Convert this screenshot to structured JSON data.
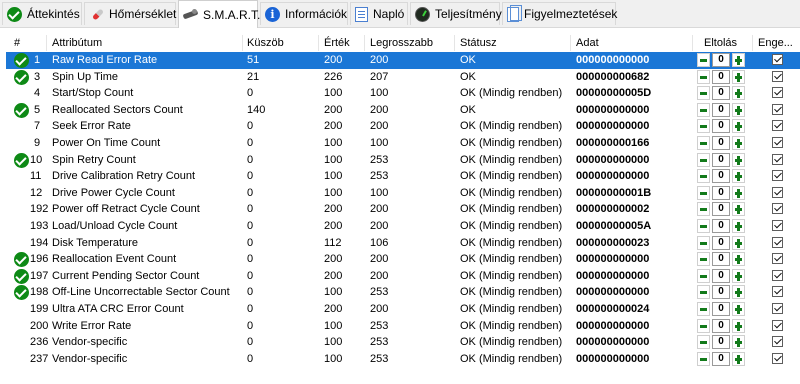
{
  "tabs": [
    {
      "label": "Áttekintés",
      "icon": "check-circle-icon"
    },
    {
      "label": "Hőmérséklet",
      "icon": "thermometer-icon"
    },
    {
      "label": "S.M.A.R.T.",
      "icon": "smart-disk-icon",
      "active": true
    },
    {
      "label": "Információk",
      "icon": "info-icon"
    },
    {
      "label": "Napló",
      "icon": "log-document-icon"
    },
    {
      "label": "Teljesítmény",
      "icon": "performance-gauge-icon"
    },
    {
      "label": "Figyelmeztetések",
      "icon": "alerts-pages-icon"
    }
  ],
  "columns": {
    "id": "#",
    "attribute": "Attribútum",
    "threshold": "Küszöb",
    "value": "Érték",
    "worst": "Legrosszabb",
    "status": "Státusz",
    "raw": "Adat",
    "offset": "Eltolás",
    "enabled": "Enge..."
  },
  "colors": {
    "selected_row": "#1b77d6",
    "ok_icon": "#0e8a16",
    "stepper_icon": "#127a1a"
  },
  "rows": [
    {
      "id": "1",
      "name": "Raw Read Error Rate",
      "threshold": "51",
      "value": "200",
      "worst": "200",
      "status": "OK",
      "raw": "000000000000",
      "offset": "0",
      "ok_icon": true,
      "selected": true
    },
    {
      "id": "3",
      "name": "Spin Up Time",
      "threshold": "21",
      "value": "226",
      "worst": "207",
      "status": "OK",
      "raw": "000000000682",
      "offset": "0",
      "ok_icon": true
    },
    {
      "id": "4",
      "name": "Start/Stop Count",
      "threshold": "0",
      "value": "100",
      "worst": "100",
      "status": "OK (Mindig rendben)",
      "raw": "00000000005D",
      "offset": "0"
    },
    {
      "id": "5",
      "name": "Reallocated Sectors Count",
      "threshold": "140",
      "value": "200",
      "worst": "200",
      "status": "OK",
      "raw": "000000000000",
      "offset": "0",
      "ok_icon": true
    },
    {
      "id": "7",
      "name": "Seek Error Rate",
      "threshold": "0",
      "value": "200",
      "worst": "200",
      "status": "OK (Mindig rendben)",
      "raw": "000000000000",
      "offset": "0"
    },
    {
      "id": "9",
      "name": "Power On Time Count",
      "threshold": "0",
      "value": "100",
      "worst": "100",
      "status": "OK (Mindig rendben)",
      "raw": "000000000166",
      "offset": "0"
    },
    {
      "id": "10",
      "name": "Spin Retry Count",
      "threshold": "0",
      "value": "100",
      "worst": "253",
      "status": "OK (Mindig rendben)",
      "raw": "000000000000",
      "offset": "0",
      "ok_icon": true
    },
    {
      "id": "11",
      "name": "Drive Calibration Retry Count",
      "threshold": "0",
      "value": "100",
      "worst": "253",
      "status": "OK (Mindig rendben)",
      "raw": "000000000000",
      "offset": "0"
    },
    {
      "id": "12",
      "name": "Drive Power Cycle Count",
      "threshold": "0",
      "value": "100",
      "worst": "100",
      "status": "OK (Mindig rendben)",
      "raw": "00000000001B",
      "offset": "0"
    },
    {
      "id": "192",
      "name": "Power off Retract Cycle Count",
      "threshold": "0",
      "value": "200",
      "worst": "200",
      "status": "OK (Mindig rendben)",
      "raw": "000000000002",
      "offset": "0"
    },
    {
      "id": "193",
      "name": "Load/Unload Cycle Count",
      "threshold": "0",
      "value": "200",
      "worst": "200",
      "status": "OK (Mindig rendben)",
      "raw": "00000000005A",
      "offset": "0"
    },
    {
      "id": "194",
      "name": "Disk Temperature",
      "threshold": "0",
      "value": "112",
      "worst": "106",
      "status": "OK (Mindig rendben)",
      "raw": "000000000023",
      "offset": "0"
    },
    {
      "id": "196",
      "name": "Reallocation Event Count",
      "threshold": "0",
      "value": "200",
      "worst": "200",
      "status": "OK (Mindig rendben)",
      "raw": "000000000000",
      "offset": "0",
      "ok_icon": true
    },
    {
      "id": "197",
      "name": "Current Pending Sector Count",
      "threshold": "0",
      "value": "200",
      "worst": "200",
      "status": "OK (Mindig rendben)",
      "raw": "000000000000",
      "offset": "0",
      "ok_icon": true
    },
    {
      "id": "198",
      "name": "Off-Line Uncorrectable Sector Count",
      "threshold": "0",
      "value": "100",
      "worst": "253",
      "status": "OK (Mindig rendben)",
      "raw": "000000000000",
      "offset": "0",
      "ok_icon": true
    },
    {
      "id": "199",
      "name": "Ultra ATA CRC Error Count",
      "threshold": "0",
      "value": "200",
      "worst": "200",
      "status": "OK (Mindig rendben)",
      "raw": "000000000024",
      "offset": "0"
    },
    {
      "id": "200",
      "name": "Write Error Rate",
      "threshold": "0",
      "value": "100",
      "worst": "253",
      "status": "OK (Mindig rendben)",
      "raw": "000000000000",
      "offset": "0"
    },
    {
      "id": "236",
      "name": "Vendor-specific",
      "threshold": "0",
      "value": "100",
      "worst": "253",
      "status": "OK (Mindig rendben)",
      "raw": "000000000000",
      "offset": "0"
    },
    {
      "id": "237",
      "name": "Vendor-specific",
      "threshold": "0",
      "value": "100",
      "worst": "253",
      "status": "OK (Mindig rendben)",
      "raw": "000000000000",
      "offset": "0"
    }
  ]
}
